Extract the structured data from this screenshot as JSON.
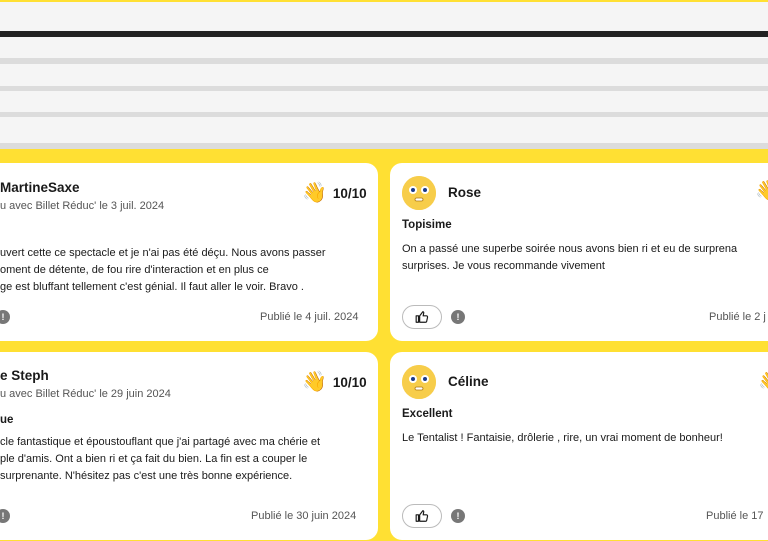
{
  "reviews": [
    {
      "author": "MartineSaxe",
      "origin": "u avec Billet Réduc' le 3 juil. 2024",
      "title": "",
      "score": "10/10",
      "body": [
        "uvert cette ce spectacle et je n'ai pas été déçu. Nous avons passer",
        "oment de détente, de fou rire d'interaction et en plus ce",
        "ge est bluffant tellement c'est génial. Il faut aller le voir. Bravo ."
      ],
      "published": "Publié le 4 juil. 2024"
    },
    {
      "author": "Rose",
      "origin": "",
      "title": "Topisime",
      "score": "",
      "body": [
        "On a passé une superbe soirée nous avons bien ri et eu de surprena",
        "surprises. Je vous recommande vivement"
      ],
      "published": "Publié le 2 j"
    },
    {
      "author": "e Steph",
      "origin": "u avec Billet Réduc' le 29 juin 2024",
      "title": "ue",
      "score": "10/10",
      "body": [
        "cle fantastique et époustouflant que j'ai partagé avec ma chérie et",
        "ple d'amis. Ont a bien ri et ça fait du bien. La fin est a couper le",
        "surprenante. N'hésitez pas c'est une très bonne expérience."
      ],
      "published": "Publié le 30 juin 2024"
    },
    {
      "author": "Céline",
      "origin": "",
      "title": "Excellent",
      "score": "",
      "body": [
        "Le Tentalist ! Fantaisie, drôlerie , rire, un vrai moment de bonheur!"
      ],
      "published": "Publié le 17"
    }
  ],
  "icons": {
    "clap": "clapping-hands-icon",
    "avatar": "smiley-avatar-icon",
    "like": "thumbs-up-icon",
    "report": "report-icon"
  },
  "colors": {
    "background": "#ffe033",
    "card": "#ffffff",
    "avatar": "#f7cd4a"
  }
}
